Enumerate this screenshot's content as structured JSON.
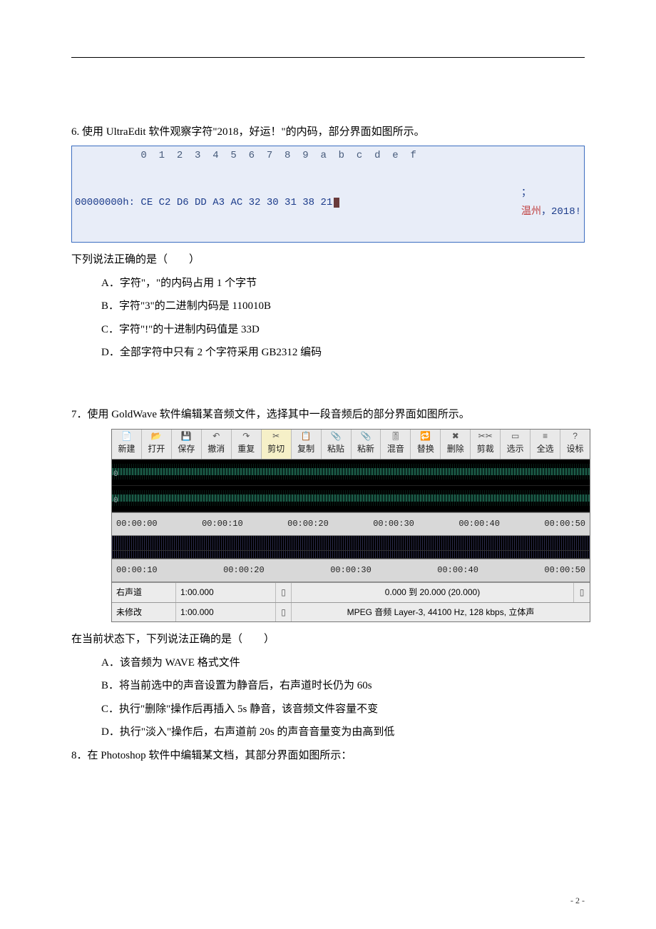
{
  "q6": {
    "text": "6. 使用 UltraEdit 软件观察字符\"2018，好运！\"的内码，部分界面如图所示。",
    "prompt": "下列说法正确的是（　　）",
    "options": {
      "A": "A．字符\"，\"的内码占用 1 个字节",
      "B": "B．字符\"3\"的二进制内码是 110010B",
      "C": "C．字符\"!\"的十进制内码值是 33D",
      "D": "D．全部字符中只有 2 个字符采用 GB2312 编码"
    }
  },
  "hex": {
    "header": "           0  1  2  3  4  5  6  7  8  9  a  b  c  d  e  f",
    "addr": "00000000h:",
    "bytes": " CE C2 D6 DD A3 AC 32 30 31 38 21",
    "decoded_sep": "；",
    "decoded_zh": "温州",
    "decoded_tail": "，2018!"
  },
  "q7": {
    "text": "7．使用 GoldWave 软件编辑某音频文件，选择其中一段音频后的部分界面如图所示。",
    "prompt": "在当前状态下，下列说法正确的是（　　）",
    "options": {
      "A": "A．该音频为 WAVE 格式文件",
      "B": "B．将当前选中的声音设置为静音后，右声道时长仍为 60s",
      "C": "C．执行\"删除\"操作后再插入 5s 静音，该音频文件容量不变",
      "D": "D．执行\"淡入\"操作后，右声道前 20s 的声音音量变为由高到低"
    }
  },
  "gw": {
    "toolbar": [
      "新建",
      "打开",
      "保存",
      "撤消",
      "重复",
      "剪切",
      "复制",
      "粘贴",
      "粘新",
      "混音",
      "替换",
      "删除",
      "剪裁",
      "选示",
      "全选",
      "设标"
    ],
    "icons": [
      "📄",
      "📂",
      "💾",
      "↶",
      "↷",
      "✂",
      "📋",
      "📎",
      "📎",
      "🎚",
      "🔁",
      "✖",
      "✂✂",
      "▭",
      "≡",
      "?"
    ],
    "active_index": 5,
    "times_top": [
      "00:00:00",
      "00:00:10",
      "00:00:20",
      "00:00:30",
      "00:00:40",
      "00:00:50"
    ],
    "times_bot": [
      "00:00:10",
      "00:00:20",
      "00:00:30",
      "00:00:40",
      "00:00:50"
    ],
    "channel_zero": "0",
    "status1": {
      "left": "右声道",
      "time": "1:00.000",
      "sel": "0.000 到 20.000 (20.000)"
    },
    "status2": {
      "left": "未修改",
      "time": "1:00.000",
      "info": "MPEG 音频 Layer-3, 44100 Hz, 128 kbps, 立体声"
    }
  },
  "q8": {
    "text": "8．在 Photoshop 软件中编辑某文档，其部分界面如图所示："
  },
  "page_num": "- 2 -"
}
